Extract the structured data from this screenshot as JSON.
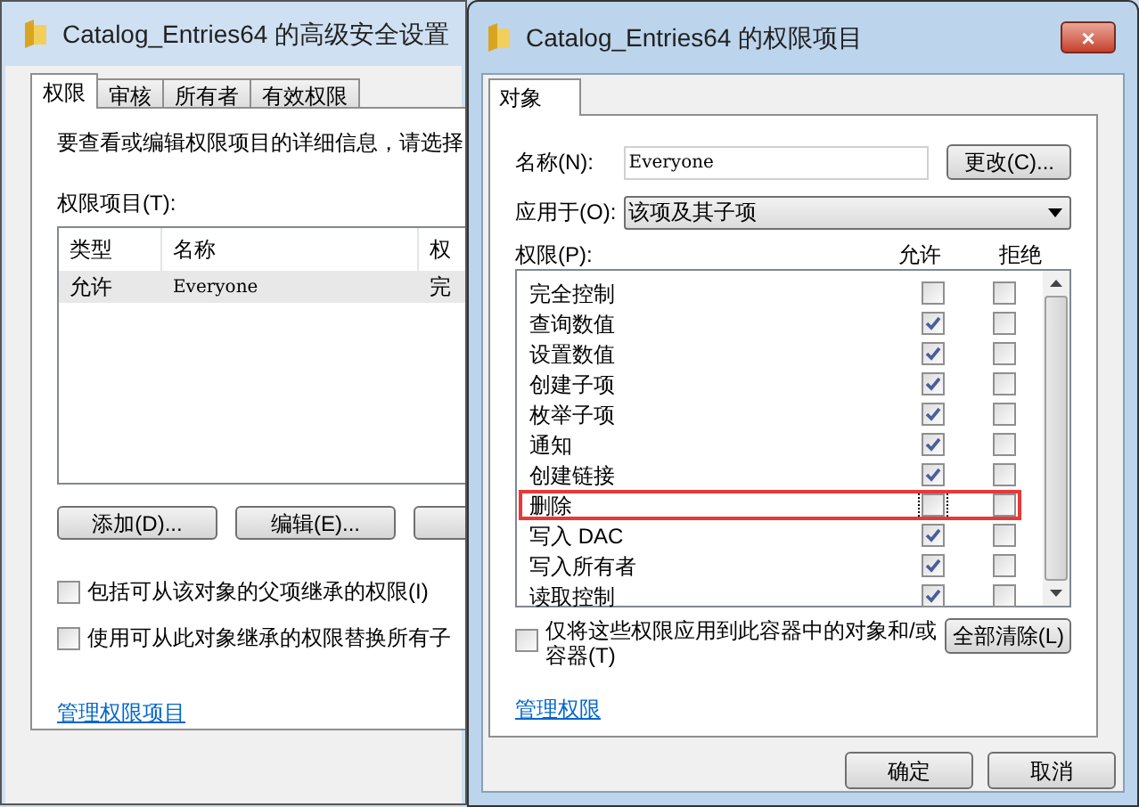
{
  "back_window": {
    "title": "Catalog_Entries64 的高级安全设置",
    "tabs": [
      {
        "label": "权限",
        "selected": true
      },
      {
        "label": "审核",
        "selected": false
      },
      {
        "label": "所有者",
        "selected": false
      },
      {
        "label": "有效权限",
        "selected": false
      }
    ],
    "description": "要查看或编辑权限项目的详细信息，请选择",
    "list_label": "权限项目(T):",
    "table": {
      "columns": [
        "类型",
        "名称",
        "权"
      ],
      "rows": [
        {
          "cells": [
            "允许",
            "Everyone",
            "完"
          ],
          "selected": true
        }
      ]
    },
    "buttons": [
      "添加(D)...",
      "编辑(E)..."
    ],
    "options": [
      {
        "label": "包括可从该对象的父项继承的权限(I)",
        "checked": false
      },
      {
        "label": "使用可从此对象继承的权限替换所有子",
        "checked": false
      }
    ],
    "link": "管理权限项目"
  },
  "dialog": {
    "title": "Catalog_Entries64 的权限项目",
    "close": "×",
    "tabs": [
      {
        "label": "对象",
        "selected": true
      }
    ],
    "name_label": "名称(N):",
    "name_value": "Everyone",
    "change_button": "更改(C)...",
    "apply_label": "应用于(O):",
    "apply_value": "该项及其子项",
    "permissions_label": "权限(P):",
    "allow_header": "允许",
    "deny_header": "拒绝",
    "permissions": [
      {
        "name": "完全控制",
        "allow": false,
        "deny": false,
        "highlighted": false
      },
      {
        "name": "查询数值",
        "allow": true,
        "deny": false,
        "highlighted": false
      },
      {
        "name": "设置数值",
        "allow": true,
        "deny": false,
        "highlighted": false
      },
      {
        "name": "创建子项",
        "allow": true,
        "deny": false,
        "highlighted": false
      },
      {
        "name": "枚举子项",
        "allow": true,
        "deny": false,
        "highlighted": false
      },
      {
        "name": "通知",
        "allow": true,
        "deny": false,
        "highlighted": false
      },
      {
        "name": "创建链接",
        "allow": true,
        "deny": false,
        "highlighted": false
      },
      {
        "name": "删除",
        "allow": false,
        "deny": false,
        "highlighted": true
      },
      {
        "name": "写入 DAC",
        "allow": true,
        "deny": false,
        "highlighted": false
      },
      {
        "name": "写入所有者",
        "allow": true,
        "deny": false,
        "highlighted": false
      },
      {
        "name": "读取控制",
        "allow": true,
        "deny": false,
        "highlighted": false
      }
    ],
    "apply_only": {
      "label": "仅将这些权限应用到此容器中的对象和/或容器(T)",
      "checked": false
    },
    "clear_button": "全部清除(L)",
    "link": "管理权限",
    "ok_button": "确定",
    "cancel_button": "取消"
  }
}
